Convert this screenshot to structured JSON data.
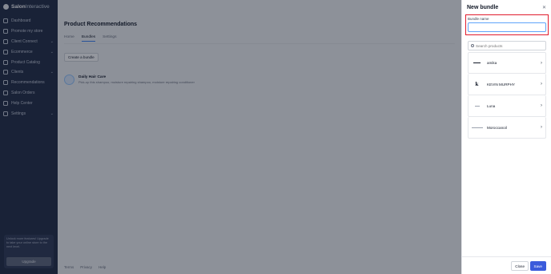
{
  "app": {
    "brand_bold": "Salon",
    "brand_light": "Interactive"
  },
  "sidebar": {
    "items": [
      {
        "label": "Dashboard",
        "icon": "grid-icon",
        "has_chevron": false
      },
      {
        "label": "Promote my store",
        "icon": "megaphone-icon",
        "has_chevron": false
      },
      {
        "label": "Client Connect",
        "icon": "send-icon",
        "has_chevron": true
      },
      {
        "label": "Ecommerce",
        "icon": "globe-icon",
        "has_chevron": true
      },
      {
        "label": "Product Catalog",
        "icon": "tag-icon",
        "has_chevron": false
      },
      {
        "label": "Clients",
        "icon": "users-icon",
        "has_chevron": true
      },
      {
        "label": "Recommendations",
        "icon": "heart-icon",
        "has_chevron": false
      },
      {
        "label": "Salon Orders",
        "icon": "receipt-icon",
        "has_chevron": false
      },
      {
        "label": "Help Center",
        "icon": "help-icon",
        "has_chevron": false
      },
      {
        "label": "Settings",
        "icon": "gear-icon",
        "has_chevron": true
      }
    ],
    "promo_text": "Unlock more features! Upgrade to take your online store to the next level.",
    "upgrade_label": "Upgrade"
  },
  "main": {
    "title": "Product Recommendations",
    "tabs": [
      "Home",
      "Bundles",
      "Settings"
    ],
    "active_tab": "Bundles",
    "create_button": "Create a bundle",
    "bundle": {
      "name": "Daily Hair Care",
      "description": "Pick-up this shampoo, moisture repairing shampoo, moisture repairing conditioner"
    },
    "footer_links": [
      "Terms",
      "Privacy",
      "Help"
    ]
  },
  "drawer": {
    "title": "New bundle",
    "field_label": "Bundle name",
    "field_value": "",
    "search_placeholder": "Search products",
    "brands": [
      {
        "name": "amika",
        "logo": "line"
      },
      {
        "name": "KEVIN MURPHY",
        "logo": "k"
      },
      {
        "name": "Luna",
        "logo": "dash"
      },
      {
        "name": "Moroccanoil",
        "logo": "thin"
      }
    ],
    "close_label": "Close",
    "save_label": "Save"
  },
  "colors": {
    "sidebar_bg": "#1f2a44",
    "accent": "#3b5bdb",
    "highlight": "#e11d2e"
  }
}
